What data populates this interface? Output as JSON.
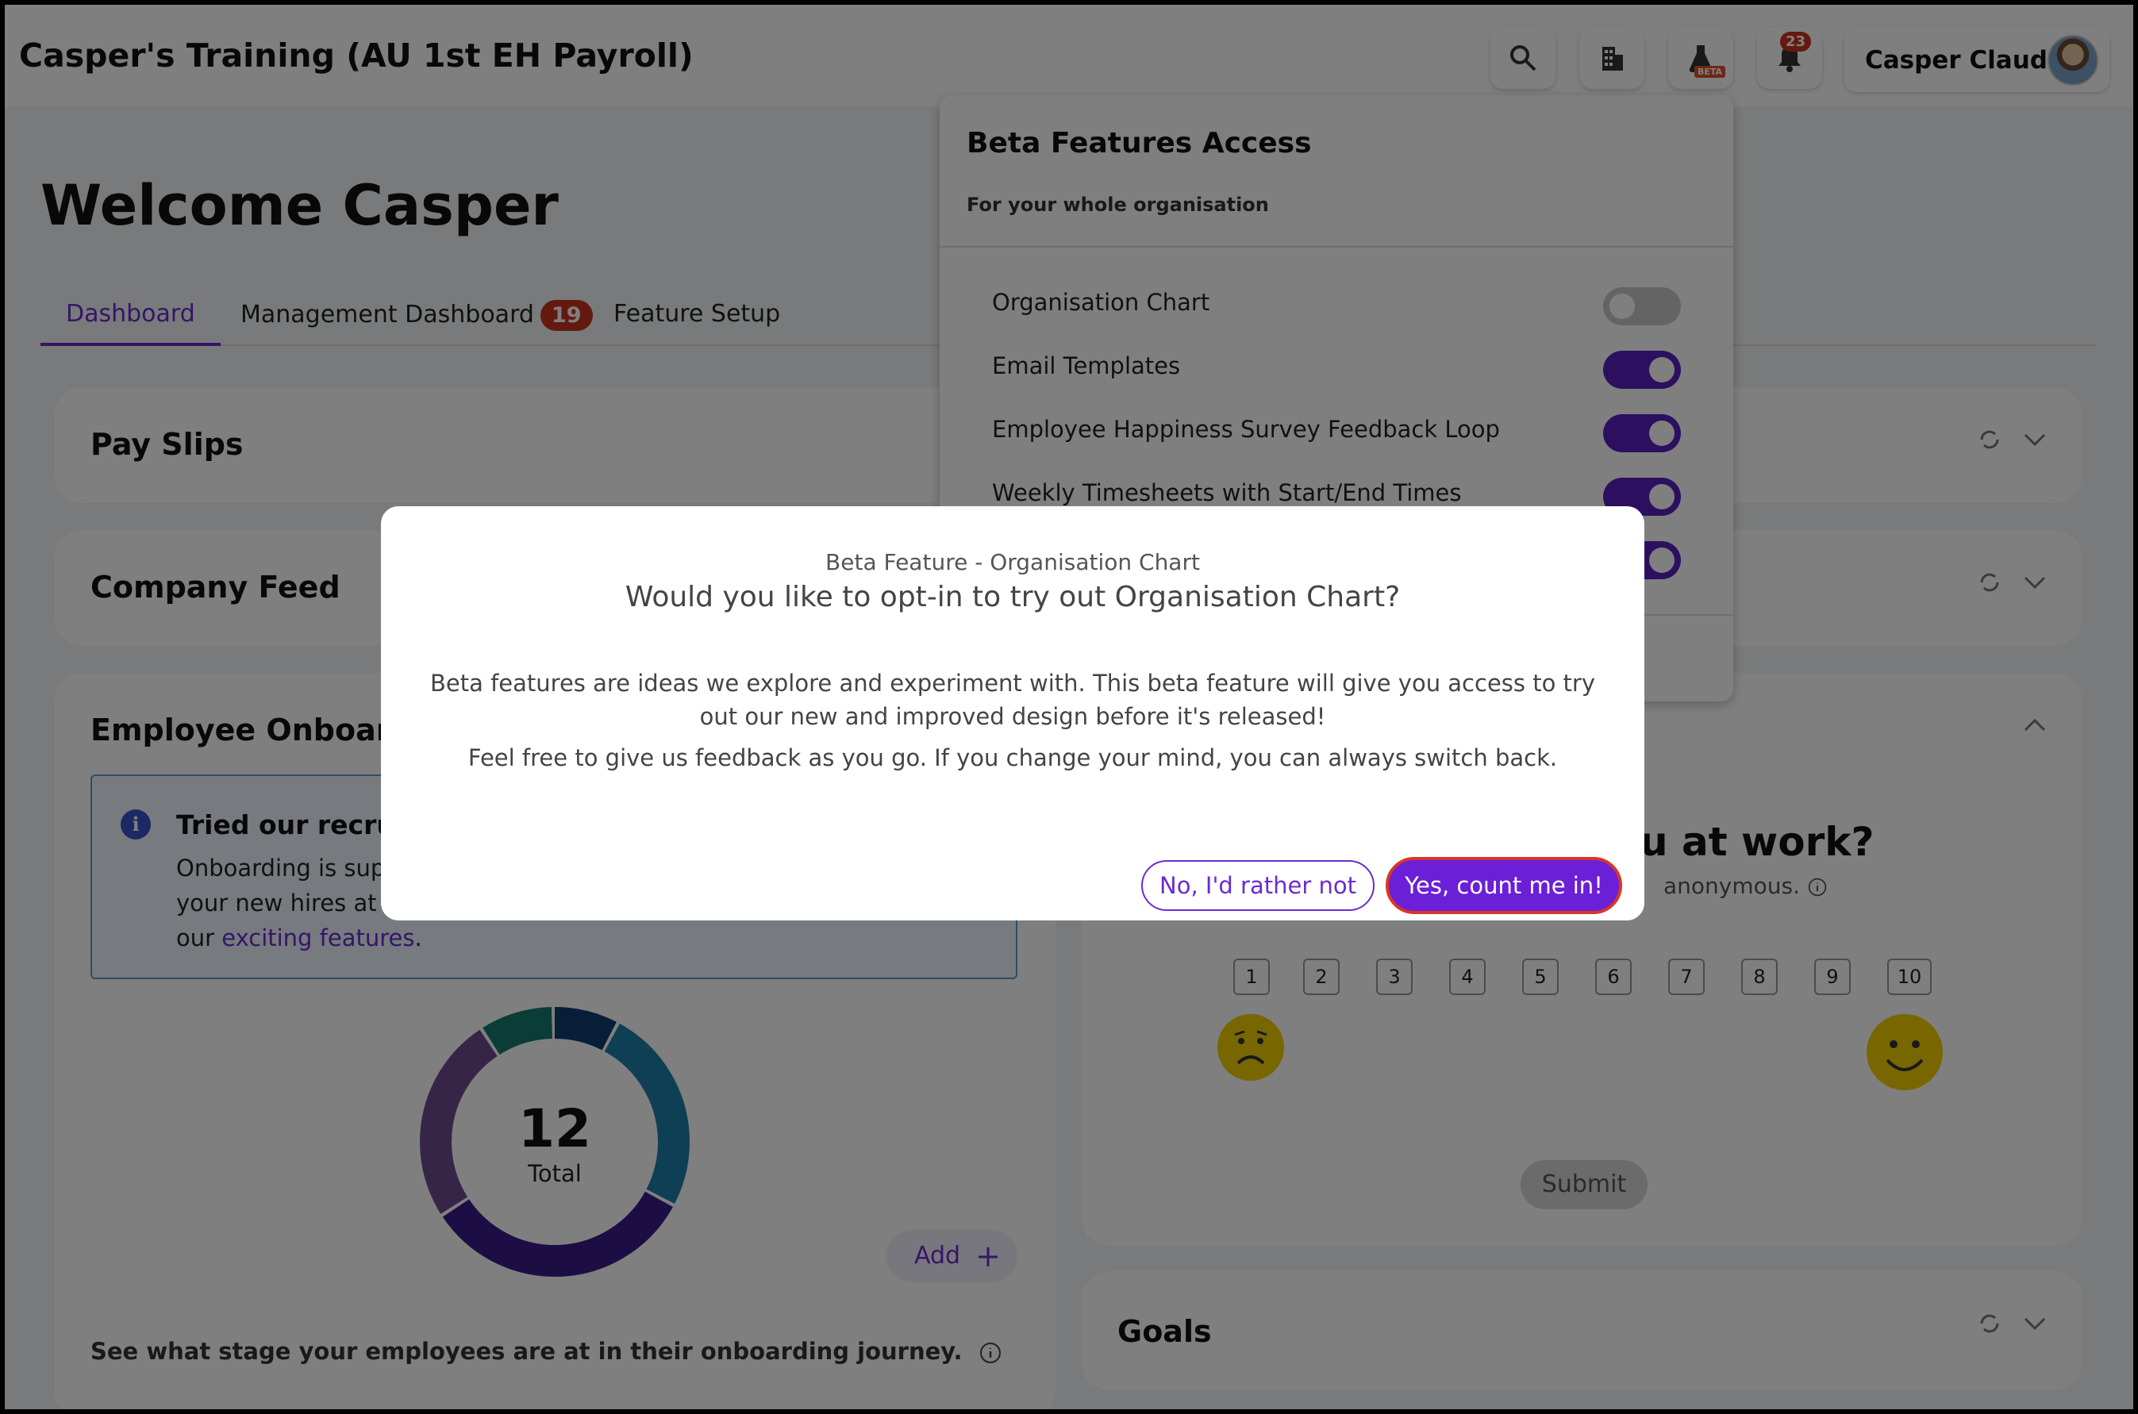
{
  "header": {
    "title": "Casper's Training (AU 1st EH Payroll)",
    "notification_count": "23",
    "beta_tag": "BETA",
    "user_name": "Casper Claude"
  },
  "welcome": "Welcome Casper",
  "tabs": [
    {
      "label": "Dashboard",
      "active": true
    },
    {
      "label": "Management Dashboard",
      "badge": "19"
    },
    {
      "label": "Feature Setup"
    }
  ],
  "cards": {
    "payslips": "Pay Slips",
    "company_feed": "Company Feed",
    "onboarding": "Employee Onboardin",
    "goals": "Goals"
  },
  "onboarding": {
    "info_title": "Tried our recruit",
    "info_line1": "Onboarding is supe",
    "info_line2": "your new hires at th",
    "info_line3_prefix": "our ",
    "info_link": "exciting features",
    "info_line3_suffix": ".",
    "total": "12",
    "total_label": "Total",
    "add_label": "Add",
    "stage_text": "See what stage your employees are at in their onboarding journey.",
    "donut_segments": [
      {
        "color": "#0f3c73",
        "fraction": 0.08
      },
      {
        "color": "#1f7fa8",
        "fraction": 0.25
      },
      {
        "color": "#3b1a8a",
        "fraction": 0.33
      },
      {
        "color": "#6e4a8e",
        "fraction": 0.25
      },
      {
        "color": "#157a6e",
        "fraction": 0.09
      }
    ]
  },
  "happiness": {
    "question": "u at work?",
    "sub": "anonymous.",
    "scale": [
      "1",
      "2",
      "3",
      "4",
      "5",
      "6",
      "7",
      "8",
      "9",
      "10"
    ],
    "submit": "Submit"
  },
  "beta_panel": {
    "title": "Beta Features Access",
    "subtitle": "For your whole organisation",
    "features": [
      {
        "label": "Organisation Chart",
        "enabled": false
      },
      {
        "label": "Email Templates",
        "enabled": true
      },
      {
        "label": "Employee Happiness Survey Feedback Loop",
        "enabled": true
      },
      {
        "label": "Weekly Timesheets with Start/End Times",
        "enabled": true
      }
    ]
  },
  "modal": {
    "kicker": "Beta Feature - Organisation Chart",
    "title": "Would you like to opt-in to try out Organisation Chart?",
    "body1": "Beta features are ideas we explore and experiment with. This beta feature will give you access to try out our new and improved design before it's released!",
    "body2": "Feel free to give us feedback as you go. If you change your mind, you can always switch back.",
    "decline": "No, I'd rather not",
    "accept": "Yes, count me in!"
  },
  "colors": {
    "accent": "#6b2bd1",
    "badge": "#c9321f",
    "toggle_on": "#5b1fbf"
  }
}
